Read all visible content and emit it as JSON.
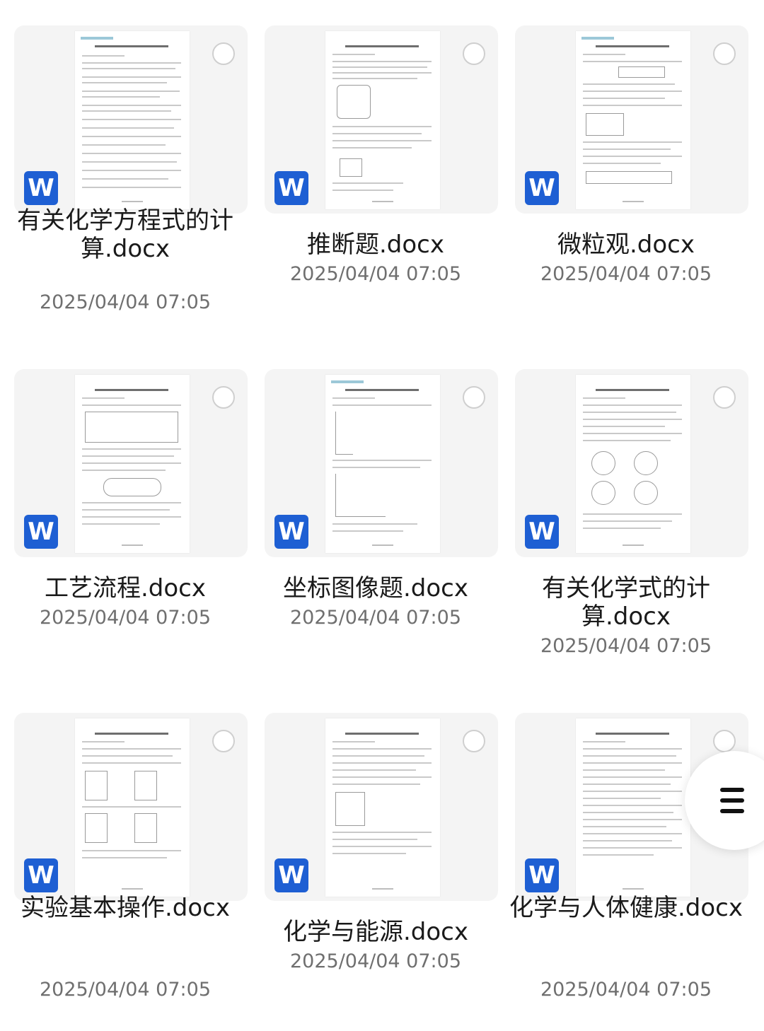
{
  "files": [
    {
      "name": "有关化学方程式的计算.docx",
      "date": "2025/04/04 07:05",
      "icon": "word-icon"
    },
    {
      "name": "推断题.docx",
      "date": "2025/04/04 07:05",
      "icon": "word-icon"
    },
    {
      "name": "微粒观.docx",
      "date": "2025/04/04 07:05",
      "icon": "word-icon"
    },
    {
      "name": "工艺流程.docx",
      "date": "2025/04/04 07:05",
      "icon": "word-icon"
    },
    {
      "name": "坐标图像题.docx",
      "date": "2025/04/04 07:05",
      "icon": "word-icon"
    },
    {
      "name": "有关化学式的计算.docx",
      "date": "2025/04/04 07:05",
      "icon": "word-icon"
    },
    {
      "name": "实验基本操作.docx",
      "date": "2025/04/04 07:05",
      "icon": "word-icon"
    },
    {
      "name": "化学与能源.docx",
      "date": "2025/04/04 07:05",
      "icon": "word-icon"
    },
    {
      "name": "化学与人体健康.docx",
      "date": "2025/04/04 07:05",
      "icon": "word-icon"
    }
  ],
  "word_icon_letter": "W",
  "colors": {
    "word_blue": "#1e5fd3",
    "text": "#1a1a1a",
    "date_gray": "#6f6f6f"
  },
  "floating_menu": {
    "icon": "hamburger-menu-icon"
  }
}
